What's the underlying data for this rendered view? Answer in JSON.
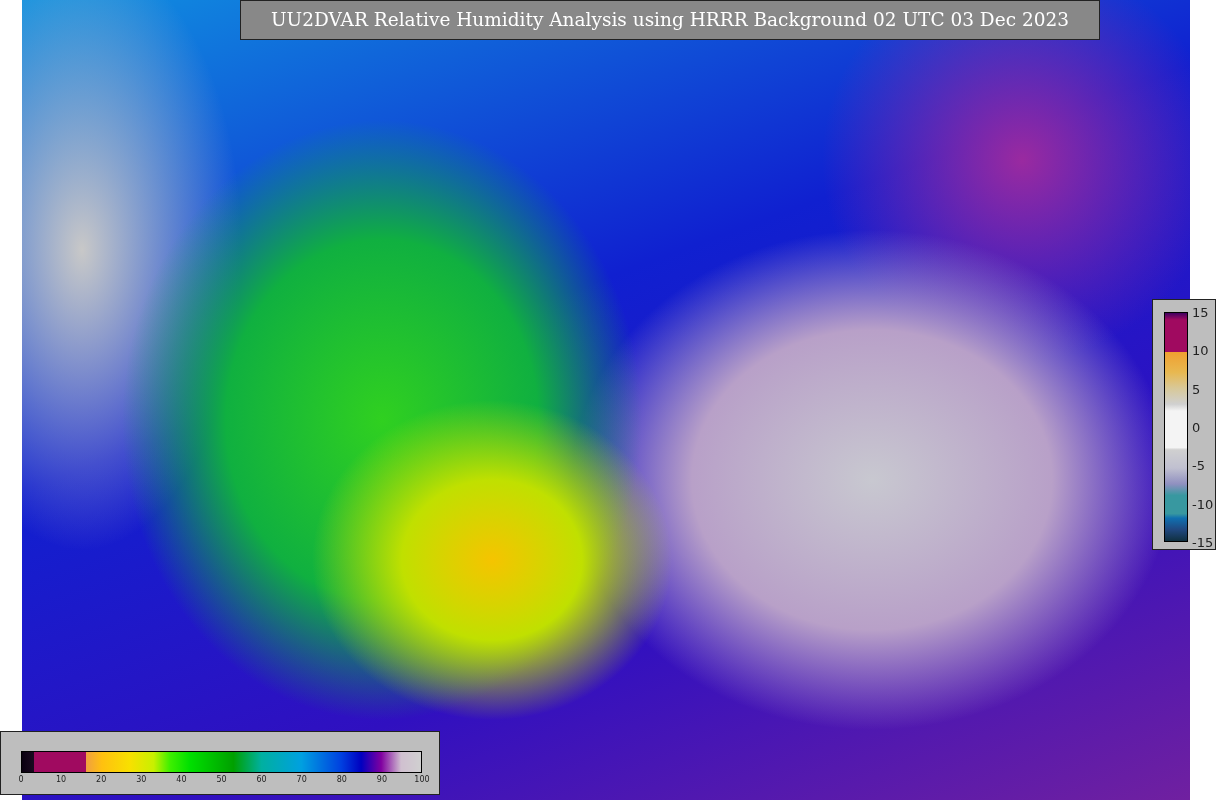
{
  "title": "UU2DVAR Relative Humidity Analysis using HRRR Background 02 UTC 03 Dec 2023",
  "colorbars": [
    {
      "kind": "horizontal",
      "ticks": [
        "0",
        "10",
        "20",
        "30",
        "40",
        "50",
        "60",
        "70",
        "80",
        "90",
        "100"
      ]
    },
    {
      "kind": "vertical",
      "ticks": [
        "15",
        "10",
        "5",
        "0",
        "-5",
        "-10",
        "-15"
      ]
    }
  ]
}
